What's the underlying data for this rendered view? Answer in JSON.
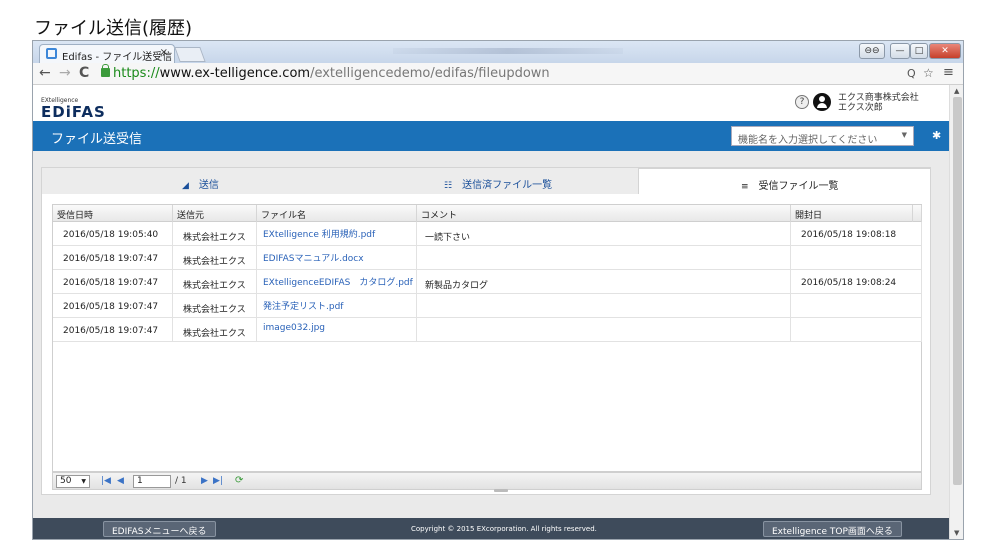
{
  "caption": "ファイル送信(履歴)",
  "browser": {
    "tab_title": "Edifas - ファイル送受信",
    "tab_close": "×",
    "url_scheme": "https://",
    "url_host": "www.ex-telligence.com",
    "url_path": "/extelligencedemo/edifas/fileupdown",
    "win_controls": {
      "account": "⊖⊖",
      "min": "—",
      "max": "□",
      "close": "✕"
    },
    "nav": {
      "back": "←",
      "forward": "→",
      "reload": "C",
      "zoom": "Q",
      "star": "☆",
      "menu": "≡"
    }
  },
  "header": {
    "logo_small": "EXtelligence",
    "logo_big": "EDiFAS",
    "help_glyph": "?",
    "company_name": "エクス商事株式会社",
    "user_name": "エクス次郎"
  },
  "titlebar": {
    "title": "ファイル送受信",
    "function_select_placeholder": "機能名を入力選択してください"
  },
  "tabs": [
    {
      "icon": "◢",
      "label": "送信",
      "active": false
    },
    {
      "icon": "☷",
      "label": "送信済ファイル一覧",
      "active": false
    },
    {
      "icon": "≡",
      "label": "受信ファイル一覧",
      "active": true
    }
  ],
  "table": {
    "columns": [
      "受信日時",
      "送信元",
      "ファイル名",
      "コメント",
      "開封日"
    ],
    "rows": [
      [
        "2016/05/18 19:05:40",
        "株式会社エクス",
        "EXtelligence 利用規約.pdf",
        "一読下さい",
        "2016/05/18 19:08:18"
      ],
      [
        "2016/05/18 19:07:47",
        "株式会社エクス",
        "EDIFASマニュアル.docx",
        "",
        ""
      ],
      [
        "2016/05/18 19:07:47",
        "株式会社エクス",
        "EXtelligenceEDIFAS　カタログ.pdf",
        "新製品カタログ",
        "2016/05/18 19:08:24"
      ],
      [
        "2016/05/18 19:07:47",
        "株式会社エクス",
        "発注予定リスト.pdf",
        "",
        ""
      ],
      [
        "2016/05/18 19:07:47",
        "株式会社エクス",
        "image032.jpg",
        "",
        ""
      ]
    ]
  },
  "pager": {
    "page_size": "50",
    "first": "|◀",
    "prev": "◀",
    "current_page": "1",
    "total": "/ 1",
    "next": "▶",
    "last": "▶|",
    "refresh": "⟳"
  },
  "footer": {
    "menu_button": "EDIFASメニューへ戻る",
    "copyright": "Copyright © 2015 EXcorporation. All rights reserved.",
    "top_button": "Extelligence TOP画面へ戻る"
  }
}
